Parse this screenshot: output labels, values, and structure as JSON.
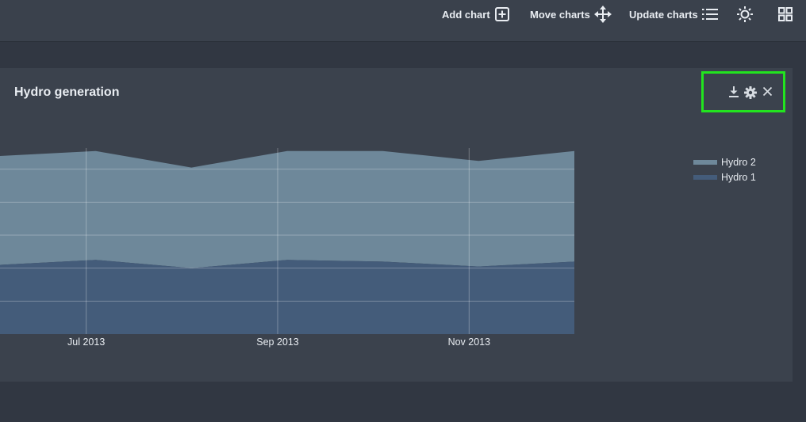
{
  "toolbar": {
    "add_chart": "Add chart",
    "move_charts": "Move charts",
    "update_charts": "Update charts",
    "icons": [
      "plus-square-icon",
      "move-arrows-icon",
      "list-icon",
      "sun-icon",
      "grid-icon"
    ]
  },
  "panel": {
    "title": "Hydro generation",
    "actions": [
      "download-icon",
      "gear-icon",
      "close-icon"
    ]
  },
  "colors": {
    "hydro2": "#6e889a",
    "hydro1": "#445c7a",
    "highlight": "#22e41f"
  },
  "chart_data": {
    "type": "area",
    "stacked": true,
    "x": [
      "2013-06",
      "2013-07",
      "2013-08",
      "2013-09",
      "2013-10",
      "2013-11",
      "2013-12"
    ],
    "x_tick_labels": [
      "Jul 2013",
      "Sep 2013",
      "Nov 2013"
    ],
    "series": [
      {
        "name": "Hydro 1",
        "values": [
          2.1,
          2.25,
          2.0,
          2.25,
          2.2,
          2.05,
          2.2
        ]
      },
      {
        "name": "Hydro 2",
        "values": [
          3.3,
          3.3,
          3.05,
          3.3,
          3.35,
          3.2,
          3.35
        ]
      }
    ],
    "ylim": [
      0,
      6
    ],
    "grid": true,
    "legend_position": "right"
  }
}
